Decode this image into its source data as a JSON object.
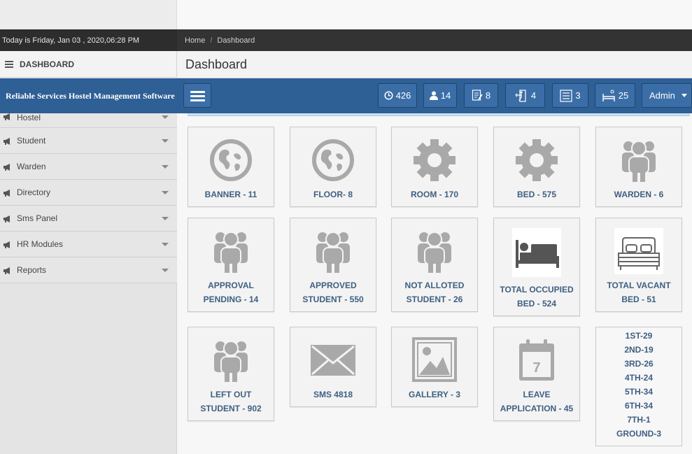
{
  "date_text": "Today is Friday, Jan 03 , 2020,06:28 PM",
  "breadcrumb": {
    "home": "Home",
    "separator": "/",
    "current": "Dashboard"
  },
  "sidebar": {
    "heading": "DASHBOARD",
    "items": [
      {
        "label": "Hostel"
      },
      {
        "label": "Student"
      },
      {
        "label": "Warden"
      },
      {
        "label": "Directory"
      },
      {
        "label": "Sms Panel"
      },
      {
        "label": "HR Modules"
      },
      {
        "label": "Reports"
      }
    ]
  },
  "page_title": "Dashboard",
  "brand": "Reliable Services Hostel Management Software",
  "navbar": {
    "badges": [
      {
        "icon": "clock-icon",
        "value": "426"
      },
      {
        "icon": "user-icon",
        "value": "14"
      },
      {
        "icon": "document-icon",
        "value": "8"
      },
      {
        "icon": "exit-door-icon",
        "value": "4"
      },
      {
        "icon": "list-icon",
        "value": "3"
      },
      {
        "icon": "bed-icon",
        "value": "25"
      }
    ],
    "user_label": "Admin"
  },
  "tiles": [
    {
      "icon": "globe-icon",
      "label": "BANNER - 11"
    },
    {
      "icon": "globe-icon",
      "label": "FLOOR- 8"
    },
    {
      "icon": "gear-icon",
      "label": "ROOM - 170"
    },
    {
      "icon": "gear-icon",
      "label": "BED - 575"
    },
    {
      "icon": "people-icon",
      "label": "WARDEN - 6"
    },
    {
      "icon": "people-icon",
      "label": "APPROVAL PENDING - 14"
    },
    {
      "icon": "people-icon",
      "label": "APPROVED STUDENT - 550"
    },
    {
      "icon": "people-icon",
      "label": "NOT ALLOTED STUDENT - 26"
    },
    {
      "icon": "occupied-bed-icon",
      "label": "TOTAL OCCUPIED BED - 524"
    },
    {
      "icon": "vacant-bed-icon",
      "label": "TOTAL VACANT BED - 51"
    },
    {
      "icon": "people-icon",
      "label": "LEFT OUT STUDENT - 902"
    },
    {
      "icon": "envelope-icon",
      "label": "SMS 4818"
    },
    {
      "icon": "picture-icon",
      "label": "GALLERY - 3"
    },
    {
      "icon": "calendar-icon",
      "label": "LEAVE APPLICATION - 45",
      "calendar_day": "7"
    }
  ],
  "floor_counts": [
    "1ST-29",
    "2ND-19",
    "3RD-26",
    "4TH-24",
    "5TH-34",
    "6TH-34",
    "7TH-1",
    "GROUND-3"
  ],
  "colors": {
    "navbar": "#2e5f95",
    "tile_label": "#3e5f82",
    "icon_gray": "#a9a9a9"
  }
}
